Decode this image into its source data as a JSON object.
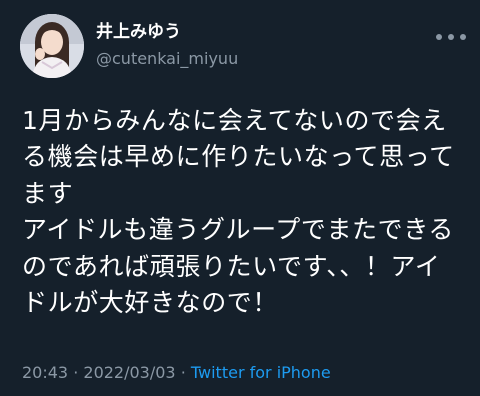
{
  "author": {
    "display_name": "井上みゆう",
    "handle": "@cutenkai_miyuu",
    "avatar": "profile-photo"
  },
  "icons": {
    "more": "more-options-icon"
  },
  "tweet": {
    "lines": [
      "1月からみんなに会えてないので会え",
      "る機会は早めに作りたいなって思って",
      "ます",
      "アイドルも違うグループでまたできる",
      "のであれば頑張りたいです、、！アイ",
      "ドルが大好きなので！"
    ]
  },
  "meta": {
    "time": "20:43",
    "separator": "·",
    "date": "2022/03/03",
    "source": "Twitter for iPhone"
  },
  "colors": {
    "background": "#15202b",
    "text": "#ffffff",
    "secondary": "#8b98a5",
    "link": "#1d9bf0"
  }
}
